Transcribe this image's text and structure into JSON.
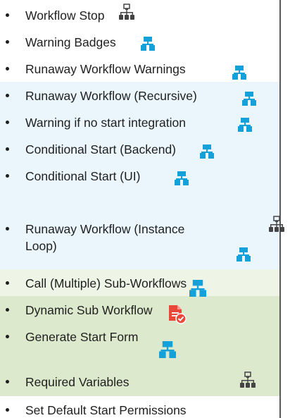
{
  "colors": {
    "light_blue": "#eaf6fb",
    "light_green": "#eef4e6",
    "medium_green": "#dde9cc",
    "blue_icon": "#14a1d9",
    "dark_icon": "#444444",
    "red_icon": "#e8473a"
  },
  "items": [
    {
      "label": "Workflow Stop",
      "icon": "workflow-network-dark-icon",
      "group": "none"
    },
    {
      "label": "Warning Badges",
      "icon": "workflow-blue-icon",
      "group": "none"
    },
    {
      "label": "Runaway Workflow Warnings",
      "icon": "workflow-blue-icon",
      "group": "none"
    },
    {
      "label": "Runaway Workflow (Recursive)",
      "icon": "workflow-blue-icon",
      "group": "light-blue"
    },
    {
      "label": "Warning if no start integration",
      "icon": "workflow-blue-icon",
      "group": "light-blue"
    },
    {
      "label": "Conditional Start (Backend)",
      "icon": "workflow-blue-icon",
      "group": "light-blue"
    },
    {
      "label": "Conditional Start (UI)",
      "icon": "workflow-blue-icon",
      "group": "light-blue"
    },
    {
      "label": "Runaway Workflow (Instance",
      "label_line2": "Loop)",
      "icon": "workflow-blue-icon",
      "extra_icon": "workflow-network-dark-icon",
      "group": "light-blue"
    },
    {
      "label": "Call (Multiple) Sub-Workflows",
      "icon": "workflow-blue-icon",
      "group": "light-green"
    },
    {
      "label": "Dynamic Sub Workflow",
      "icon": "document-check-red-icon",
      "group": "medium-green"
    },
    {
      "label": "Generate Start Form",
      "icon": "workflow-blue-icon",
      "group": "medium-green"
    },
    {
      "label": "Required Variables",
      "icon": "workflow-network-dark-icon",
      "group": "medium-green"
    },
    {
      "label": "Set Default Start Permissions",
      "group": "none"
    }
  ]
}
